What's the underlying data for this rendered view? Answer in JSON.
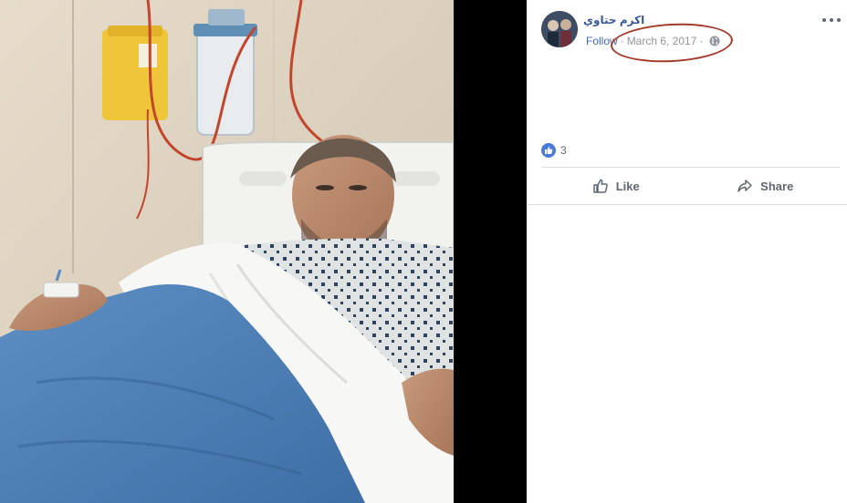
{
  "post": {
    "author_name": "اكرم حتاوي",
    "follow_label": "Follow",
    "separator": "·",
    "date": "March 6, 2017",
    "privacy_icon": "globe-icon",
    "reaction_icon": "like-badge-icon",
    "reaction_count": "3",
    "options_icon": "more-horizontal-icon"
  },
  "actions": {
    "like_label": "Like",
    "share_label": "Share"
  },
  "colors": {
    "link_blue": "#385898",
    "like_blue": "#4a7bd8",
    "highlight_red": "#a43a2a",
    "photo_letterbox": "#000000"
  }
}
